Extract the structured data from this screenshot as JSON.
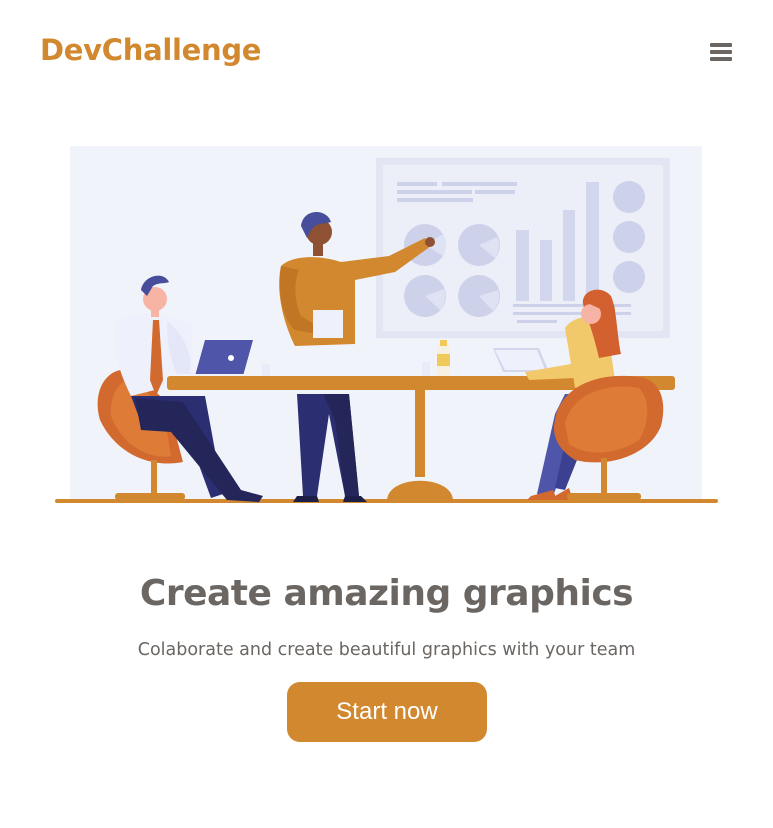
{
  "header": {
    "brand": "DevChallenge",
    "menu_icon": "hamburger-menu-icon"
  },
  "hero": {
    "illustration": "team-meeting-illustration",
    "title": "Create amazing graphics",
    "subtitle": "Colaborate and create beautiful graphics with your team",
    "cta_label": "Start now"
  },
  "colors": {
    "brand": "#d2882f",
    "text": "#6b6662",
    "button_text": "#ffffff",
    "illustration_bg": "#f1f3fa"
  }
}
